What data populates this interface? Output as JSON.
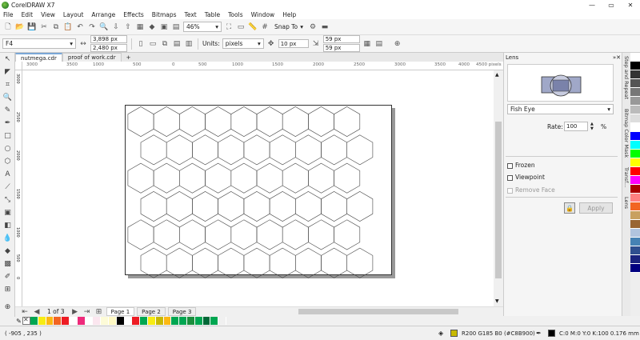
{
  "app": {
    "title": "CorelDRAW X7"
  },
  "window_controls": {
    "minimize": "—",
    "restore": "▭",
    "close": "✕"
  },
  "menu": [
    "File",
    "Edit",
    "View",
    "Layout",
    "Arrange",
    "Effects",
    "Bitmaps",
    "Text",
    "Table",
    "Tools",
    "Window",
    "Help"
  ],
  "toolbar": {
    "zoom": "46%",
    "snap": "Snap To"
  },
  "property_bar": {
    "page_size": "F4",
    "width": "3,898 px",
    "height": "2,480 px",
    "units_label": "Units:",
    "units": "pixels",
    "nudge": "10 px",
    "dup_x": "59 px",
    "dup_y": "59 px"
  },
  "doc_tabs": [
    {
      "label": "nutmega.cdr"
    },
    {
      "label": "proof of work.cdr"
    }
  ],
  "ruler": {
    "h_ticks": [
      "3000",
      "3500",
      "1000",
      "500",
      "0",
      "500",
      "1000",
      "1500",
      "2000",
      "2500",
      "3000",
      "3500",
      "4000",
      "4500 pixels"
    ],
    "v_ticks": [
      "3000",
      "2500",
      "2000",
      "1500",
      "1000",
      "500",
      "0"
    ]
  },
  "page_nav": {
    "counter": "1 of 3",
    "pages": [
      "Page 1",
      "Page 2",
      "Page 3"
    ]
  },
  "status": {
    "coords": "( -905 , 235 )",
    "fill": "R200 G185 B0 (#C8B900)",
    "outline": "C:0 M:0 Y:0 K:100  0.176 mm"
  },
  "lens": {
    "header": "Lens",
    "type": "Fish Eye",
    "rate_label": "Rate:",
    "rate": "100",
    "rate_unit": "%",
    "frozen": "Frozen",
    "viewpoint": "Viewpoint",
    "remove_face": "Remove Face",
    "apply": "Apply"
  },
  "docker_tabs": [
    "Step and Repeat",
    "Bitmap Color Mask",
    "Transf...",
    "Lens"
  ],
  "colors": {
    "palette": [
      "#00a651",
      "#f7ec13",
      "#fcb813",
      "#f26522",
      "#ed1c24",
      "#ffffff",
      "#ee2a7b",
      "#ffffff",
      "#fbe6ef",
      "#fdfbd7",
      "#fff9c4",
      "#000000",
      "#ffffff",
      "#ed1c24",
      "#00a651",
      "#f7ec13",
      "#c8b900",
      "#fcb813",
      "#00a651",
      "#00a651",
      "#1b8e3d",
      "#00a651",
      "#006837",
      "#00a651",
      "#f0f0f0"
    ],
    "vpalette": [
      "#ffffff",
      "#000000",
      "#333333",
      "#555555",
      "#777777",
      "#999999",
      "#bbbbbb",
      "#dddddd",
      "#ffffff",
      "#0000ff",
      "#00ffff",
      "#00ff00",
      "#ffff00",
      "#ff0000",
      "#ff00ff",
      "#aa0000",
      "#ff8080",
      "#f26522",
      "#c8a060",
      "#996633",
      "#b0c4de",
      "#4682b4",
      "#2f4f8f",
      "#1a237e",
      "#000080"
    ]
  }
}
